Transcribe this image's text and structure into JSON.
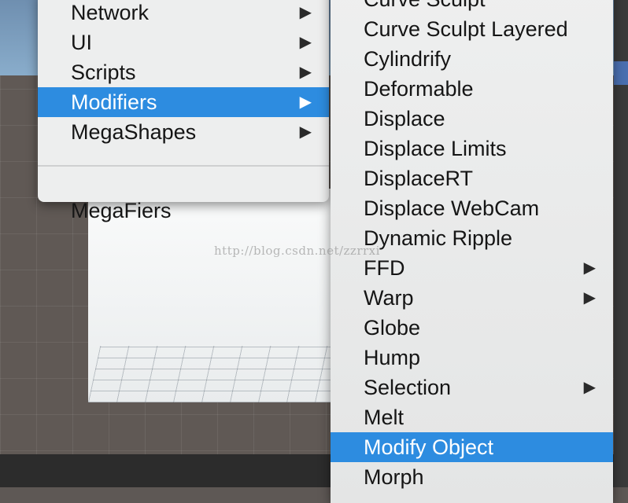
{
  "left_menu": {
    "items": [
      {
        "label": "Network",
        "submenu": true,
        "active": false
      },
      {
        "label": "UI",
        "submenu": true,
        "active": false
      },
      {
        "label": "Scripts",
        "submenu": true,
        "active": false
      },
      {
        "label": "Modifiers",
        "submenu": true,
        "active": true
      },
      {
        "label": "MegaShapes",
        "submenu": true,
        "active": false
      }
    ],
    "after_separator": [
      {
        "label": "MegaFiers",
        "submenu": false,
        "active": false
      }
    ]
  },
  "right_menu": {
    "items": [
      {
        "label": "Curve Sculpt",
        "submenu": false,
        "active": false
      },
      {
        "label": "Curve Sculpt Layered",
        "submenu": false,
        "active": false
      },
      {
        "label": "Cylindrify",
        "submenu": false,
        "active": false
      },
      {
        "label": "Deformable",
        "submenu": false,
        "active": false
      },
      {
        "label": "Displace",
        "submenu": false,
        "active": false
      },
      {
        "label": "Displace Limits",
        "submenu": false,
        "active": false
      },
      {
        "label": "DisplaceRT",
        "submenu": false,
        "active": false
      },
      {
        "label": "Displace WebCam",
        "submenu": false,
        "active": false
      },
      {
        "label": "Dynamic Ripple",
        "submenu": false,
        "active": false
      },
      {
        "label": "FFD",
        "submenu": true,
        "active": false
      },
      {
        "label": "Warp",
        "submenu": true,
        "active": false
      },
      {
        "label": "Globe",
        "submenu": false,
        "active": false
      },
      {
        "label": "Hump",
        "submenu": false,
        "active": false
      },
      {
        "label": "Selection",
        "submenu": true,
        "active": false
      },
      {
        "label": "Melt",
        "submenu": false,
        "active": false
      },
      {
        "label": "Modify Object",
        "submenu": false,
        "active": true
      },
      {
        "label": "Morph",
        "submenu": false,
        "active": false
      }
    ]
  },
  "submenu_arrow_glyph": "▶",
  "watermark": "http://blog.csdn.net/zzrrxi",
  "colors": {
    "highlight": "#2d8ce0",
    "menu_bg": "#edeeee"
  }
}
